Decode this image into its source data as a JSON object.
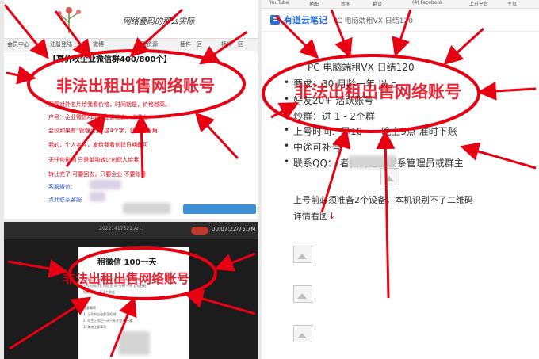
{
  "top_left": {
    "blog_title": "网络叠码的那么实际",
    "nav": [
      "会员中心",
      "注册登陆",
      "微博",
      "首页资源",
      "插件一区",
      "插件一区"
    ],
    "heading": "【高价收企业微信群400/800个】",
    "stamp": "非法出租出售网络账号",
    "lines": [
      "截图对外名片给我看价格，时间就是，价格越高。",
      "户号：企业微信App，登录进去，点右上",
      "会议如果有“管理企业”这4个字，就点右下角",
      "我的，个人名片，发给我看创建日期即可",
      "无任何影响 只是单独转让创建人给我",
      "转让完了 可要回去，只要企业 不要账号",
      "客服微信：",
      "点此联系客服"
    ]
  },
  "bottom_left": {
    "tab_text": "20221417521.Ari..",
    "timer": "00:07:22/75.7M",
    "doc_title": "租微信  100一天",
    "stamp": "非法出租出售网络账号",
    "doc_lines": [
      "Pad 功能上号  自动  年龄不限  不能看微博",
      "上号时间前上人员 注 30 分钟  一天  自动扫码",
      "电脑微信上号 1个收益",
      "注意事项",
      "1. 上号前自动登录检测",
      "2. 号主上号后一天只允许登录  不能",
      "3. 其他注意事项"
    ]
  },
  "right": {
    "bookmarks": [
      "YouTube",
      "地图",
      "新闻",
      "翻译",
      "(4) Facebook",
      "上升平台",
      "主页"
    ],
    "app_name": "有道云笔记",
    "note_title": "PC 电脑端租VX 日结120",
    "doc_heading": "PC 电脑端租VX 日结120",
    "bullets": [
      "要求：30 月龄一年 以上",
      "好友20+  活跃账号",
      "炒群：进 1 - 2个群",
      "上号时间：早10——晚上9点 准时下账",
      "中途可补号",
      "联系QQ：             者扫码进群联系管理员或群主"
    ],
    "stamp": "非法出租出售网络账号",
    "notice": "上号前必须准备2个设备，本机识别不了二维码",
    "detail": "详情看图",
    "detail_arrow": "↓"
  },
  "colors": {
    "stamp_red": "#e60012",
    "link_blue": "#3355cc"
  }
}
